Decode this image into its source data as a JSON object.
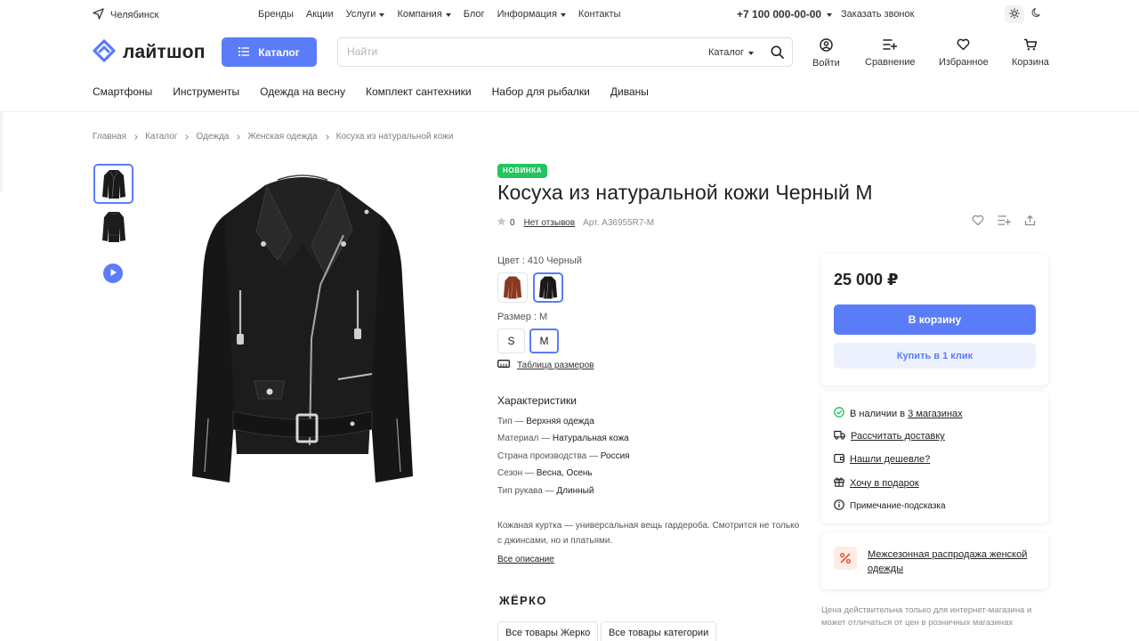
{
  "topbar": {
    "city": "Челябинск",
    "nav": [
      {
        "label": "Бренды",
        "dropdown": false
      },
      {
        "label": "Акции",
        "dropdown": false
      },
      {
        "label": "Услуги",
        "dropdown": true
      },
      {
        "label": "Компания",
        "dropdown": true
      },
      {
        "label": "Блог",
        "dropdown": false
      },
      {
        "label": "Информация",
        "dropdown": true
      },
      {
        "label": "Контакты",
        "dropdown": false
      }
    ],
    "phone": "+7 100 000-00-00",
    "callback": "Заказать звонок"
  },
  "header": {
    "logo": "лайтшоп",
    "catalog_button": "Каталог",
    "search_placeholder": "Найти",
    "search_scope": "Каталог",
    "actions": {
      "login": "Войти",
      "compare": "Сравнение",
      "favorites": "Избранное",
      "cart": "Корзина"
    }
  },
  "category_nav": [
    "Смартфоны",
    "Инструменты",
    "Одежда на весну",
    "Комплект сантехники",
    "Набор для рыбалки",
    "Диваны"
  ],
  "breadcrumb": [
    "Главная",
    "Каталог",
    "Одежда",
    "Женская одежда",
    "Косуха из натуральной кожи"
  ],
  "product": {
    "badge": "НОВИНКА",
    "title": "Косуха из натуральной кожи Черный M",
    "rating": "0",
    "reviews": "Нет отзывов",
    "sku": "Арт. A36955R7-M",
    "color_label": "Цвет : 410 Черный",
    "size_label": "Размер : M",
    "sizes": [
      "S",
      "M"
    ],
    "selected_size": "M",
    "size_table": "Таблица размеров",
    "characteristics_title": "Характеристики",
    "characteristics": [
      {
        "name": "Тип",
        "value": "Верхняя одежда"
      },
      {
        "name": "Материал",
        "value": "Натуральная кожа"
      },
      {
        "name": "Страна производства",
        "value": "Россия"
      },
      {
        "name": "Сезон",
        "value": "Весна, Осень"
      },
      {
        "name": "Тип рукава",
        "value": "Длинный"
      }
    ],
    "description": "Кожаная куртка — универсальная вещь гардероба. Смотрится не только с джинсами, но и платьями.",
    "all_description": "Все описание",
    "brand": "ЖЁРКО",
    "tags": [
      "Все товары Жерко",
      "Все товары категории"
    ]
  },
  "buy_box": {
    "price": "25 000 ₽",
    "cart_button": "В корзину",
    "one_click": "Купить в 1 клик"
  },
  "info_box": {
    "stock_prefix": "В наличии в",
    "stock_link": "3 магазинах",
    "delivery": "Рассчитать доставку",
    "cheaper": "Нашли дешевле?",
    "gift": "Хочу в подарок",
    "note": "Примечание-подсказка"
  },
  "promo": {
    "text": "Межсезонная распродажа женской одежды"
  },
  "disclaimer": "Цена действительна только для интернет-магазина и может отличаться от цен в розничных магазинах",
  "colors": {
    "accent": "#5b7cf9",
    "new_badge": "#22c55e",
    "stock_ok": "#22c55e",
    "promo_icon": "#e4572e"
  }
}
